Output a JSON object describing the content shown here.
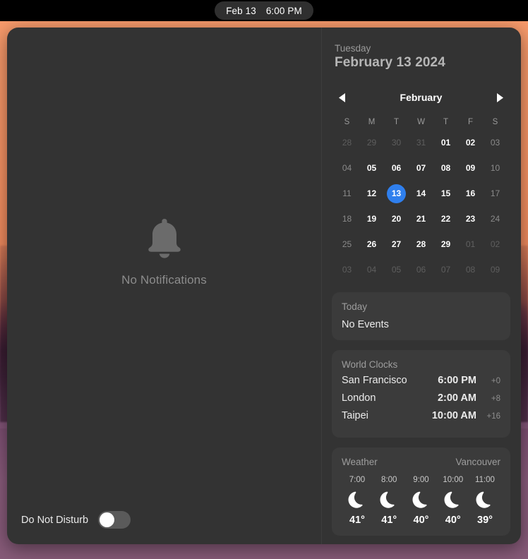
{
  "menubar": {
    "date": "Feb 13",
    "time": "6:00 PM"
  },
  "notifications": {
    "icon": "bell-icon",
    "empty_label": "No Notifications",
    "do_not_disturb": {
      "label": "Do Not Disturb",
      "state": "off"
    }
  },
  "widgets": {
    "date_header": {
      "weekday": "Tuesday",
      "full_date": "February 13 2024"
    },
    "calendar": {
      "month": "February",
      "prev_icon": "chevron-left-icon",
      "next_icon": "chevron-right-icon",
      "weekday_initials": [
        "S",
        "M",
        "T",
        "W",
        "T",
        "F",
        "S"
      ],
      "selected_day": "13",
      "accent_color": "#2f7fed",
      "weeks": [
        [
          {
            "label": "28",
            "style": "out"
          },
          {
            "label": "29",
            "style": "out"
          },
          {
            "label": "30",
            "style": "out"
          },
          {
            "label": "31",
            "style": "out"
          },
          {
            "label": "01",
            "style": "normal"
          },
          {
            "label": "02",
            "style": "normal"
          },
          {
            "label": "03",
            "style": "dim"
          }
        ],
        [
          {
            "label": "04",
            "style": "dim"
          },
          {
            "label": "05",
            "style": "normal"
          },
          {
            "label": "06",
            "style": "normal"
          },
          {
            "label": "07",
            "style": "normal"
          },
          {
            "label": "08",
            "style": "normal"
          },
          {
            "label": "09",
            "style": "normal"
          },
          {
            "label": "10",
            "style": "dim"
          }
        ],
        [
          {
            "label": "11",
            "style": "dim"
          },
          {
            "label": "12",
            "style": "normal"
          },
          {
            "label": "13",
            "style": "today"
          },
          {
            "label": "14",
            "style": "normal"
          },
          {
            "label": "15",
            "style": "normal"
          },
          {
            "label": "16",
            "style": "normal"
          },
          {
            "label": "17",
            "style": "dim"
          }
        ],
        [
          {
            "label": "18",
            "style": "dim"
          },
          {
            "label": "19",
            "style": "normal"
          },
          {
            "label": "20",
            "style": "normal"
          },
          {
            "label": "21",
            "style": "normal"
          },
          {
            "label": "22",
            "style": "normal"
          },
          {
            "label": "23",
            "style": "normal"
          },
          {
            "label": "24",
            "style": "dim"
          }
        ],
        [
          {
            "label": "25",
            "style": "dim"
          },
          {
            "label": "26",
            "style": "normal"
          },
          {
            "label": "27",
            "style": "normal"
          },
          {
            "label": "28",
            "style": "normal"
          },
          {
            "label": "29",
            "style": "normal"
          },
          {
            "label": "01",
            "style": "muted"
          },
          {
            "label": "02",
            "style": "out"
          }
        ],
        [
          {
            "label": "03",
            "style": "out"
          },
          {
            "label": "04",
            "style": "out"
          },
          {
            "label": "05",
            "style": "out"
          },
          {
            "label": "06",
            "style": "out"
          },
          {
            "label": "07",
            "style": "out"
          },
          {
            "label": "08",
            "style": "out"
          },
          {
            "label": "09",
            "style": "out"
          }
        ]
      ]
    },
    "events": {
      "title": "Today",
      "body": "No Events"
    },
    "world_clocks": {
      "title": "World Clocks",
      "rows": [
        {
          "city": "San Francisco",
          "time": "6:00 PM",
          "offset": "+0"
        },
        {
          "city": "London",
          "time": "2:00 AM",
          "offset": "+8"
        },
        {
          "city": "Taipei",
          "time": "10:00 AM",
          "offset": "+16"
        }
      ]
    },
    "weather": {
      "title": "Weather",
      "location": "Vancouver",
      "hours": [
        {
          "time": "7:00",
          "icon": "moon-icon",
          "temp": "41°"
        },
        {
          "time": "8:00",
          "icon": "moon-icon",
          "temp": "41°"
        },
        {
          "time": "9:00",
          "icon": "moon-icon",
          "temp": "40°"
        },
        {
          "time": "10:00",
          "icon": "moon-icon",
          "temp": "40°"
        },
        {
          "time": "11:00",
          "icon": "moon-icon",
          "temp": "39°"
        }
      ]
    }
  }
}
